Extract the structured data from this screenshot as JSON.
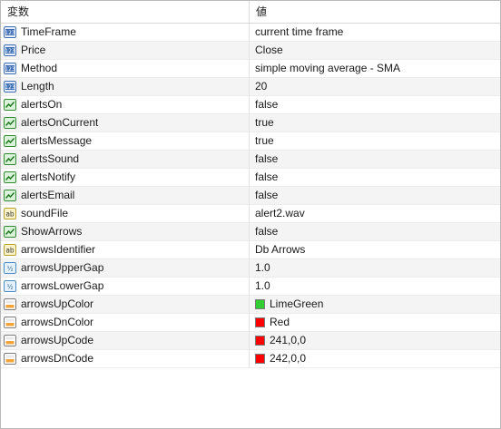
{
  "header": {
    "col_variable": "変数",
    "col_value": "値"
  },
  "colors": {
    "limegreen": "#32cd32",
    "red": "#ff0000"
  },
  "rows": [
    {
      "name": "TimeFrame",
      "value": "current time frame",
      "icon": "int-icon"
    },
    {
      "name": "Price",
      "value": "Close",
      "icon": "int-icon"
    },
    {
      "name": "Method",
      "value": "simple moving average - SMA",
      "icon": "int-icon"
    },
    {
      "name": "Length",
      "value": "20",
      "icon": "int-icon"
    },
    {
      "name": "alertsOn",
      "value": "false",
      "icon": "bool-icon"
    },
    {
      "name": "alertsOnCurrent",
      "value": "true",
      "icon": "bool-icon"
    },
    {
      "name": "alertsMessage",
      "value": "true",
      "icon": "bool-icon"
    },
    {
      "name": "alertsSound",
      "value": "false",
      "icon": "bool-icon"
    },
    {
      "name": "alertsNotify",
      "value": "false",
      "icon": "bool-icon"
    },
    {
      "name": "alertsEmail",
      "value": "false",
      "icon": "bool-icon"
    },
    {
      "name": "soundFile",
      "value": "alert2.wav",
      "icon": "string-icon"
    },
    {
      "name": "ShowArrows",
      "value": "false",
      "icon": "bool-icon"
    },
    {
      "name": "arrowsIdentifier",
      "value": "Db Arrows",
      "icon": "string-icon"
    },
    {
      "name": "arrowsUpperGap",
      "value": "1.0",
      "icon": "double-icon"
    },
    {
      "name": "arrowsLowerGap",
      "value": "1.0",
      "icon": "double-icon"
    },
    {
      "name": "arrowsUpColor",
      "value": "LimeGreen",
      "icon": "color-icon"
    },
    {
      "name": "arrowsDnColor",
      "value": "Red",
      "icon": "color-icon"
    },
    {
      "name": "arrowsUpCode",
      "value": "241,0,0",
      "icon": "color-icon"
    },
    {
      "name": "arrowsDnCode",
      "value": "242,0,0",
      "icon": "color-icon"
    }
  ]
}
